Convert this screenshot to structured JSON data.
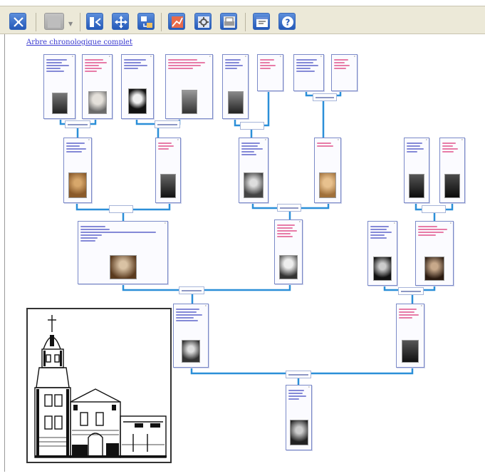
{
  "toolbar": {
    "buttons": [
      {
        "icon": "tools-icon"
      },
      {
        "icon": "blank-icon",
        "disabled": true
      },
      {
        "icon": "tree-left-icon"
      },
      {
        "icon": "move-icon"
      },
      {
        "icon": "swap-icon"
      },
      {
        "icon": "chart-icon"
      },
      {
        "icon": "settings-icon"
      },
      {
        "icon": "print-icon"
      },
      {
        "icon": "window-icon"
      },
      {
        "icon": "help-icon"
      }
    ]
  },
  "canvas": {
    "link_label": "Arbre chronologique complet"
  },
  "colors": {
    "male_text": "#5c63c9",
    "female_text": "#e0508a",
    "connector": "#2b8fd8",
    "card_border": "#7b8ac8"
  }
}
